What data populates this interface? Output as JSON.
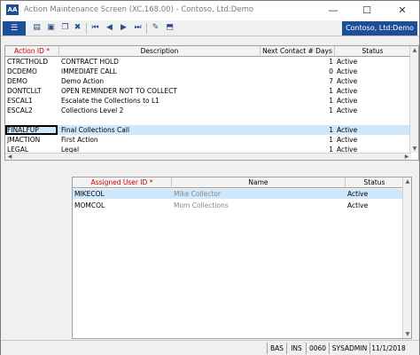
{
  "window": {
    "title": "Action Maintenance Screen (XC.168.00) - Contoso, Ltd:Demo",
    "app_icon": "AA",
    "controls": {
      "minimize": "—",
      "maximize": "☐",
      "close": "✕"
    }
  },
  "toolbar": {
    "menu_label": "☰",
    "icons": [
      "folder-open-icon",
      "save-icon",
      "copy-icon",
      "delete-icon",
      "first-icon",
      "previous-icon",
      "next-icon",
      "last-icon",
      "edit-icon",
      "export-icon"
    ],
    "company": "Contoso, Ltd:Demo"
  },
  "actions_grid": {
    "headers": {
      "action_id": "Action ID *",
      "description": "Description",
      "next_contact_days": "Next Contact # Days",
      "status": "Status"
    },
    "rows": [
      {
        "id": "CTRCTHOLD",
        "description": "CONTRACT HOLD",
        "days": "1",
        "status": "Active"
      },
      {
        "id": "DCDEMO",
        "description": "IMMEDIATE CALL",
        "days": "0",
        "status": "Active"
      },
      {
        "id": "DEMO",
        "description": "Demo Action",
        "days": "7",
        "status": "Active"
      },
      {
        "id": "DONTCLLT",
        "description": "OPEN REMINDER NOT TO COLLECT",
        "days": "1",
        "status": "Active"
      },
      {
        "id": "ESCAL1",
        "description": "Escalate the Collections to L1",
        "days": "1",
        "status": "Active"
      },
      {
        "id": "ESCAL2",
        "description": "Collections Level 2",
        "days": "1",
        "status": "Active"
      },
      {
        "id": "FINALFUP",
        "description": "Final Collections Call",
        "days": "1",
        "status": "Active"
      },
      {
        "id": "JMACTION",
        "description": "First Action",
        "days": "1",
        "status": "Active"
      },
      {
        "id": "LEGAL",
        "description": "Legal",
        "days": "1",
        "status": "Active"
      }
    ],
    "selected_index": 6
  },
  "users_grid": {
    "headers": {
      "assigned_user_id": "Assigned User ID *",
      "name": "Name",
      "status": "Status"
    },
    "rows": [
      {
        "id": "MIKECOL",
        "name": "Mike Collector",
        "status": "Active"
      },
      {
        "id": "MOMCOL",
        "name": "Mom Collections",
        "status": "Active"
      }
    ],
    "selected_index": 0
  },
  "statusbar": {
    "mode": "BAS",
    "insert": "INS",
    "cpny": "0060",
    "user": "SYSADMIN",
    "date": "11/1/2018"
  }
}
